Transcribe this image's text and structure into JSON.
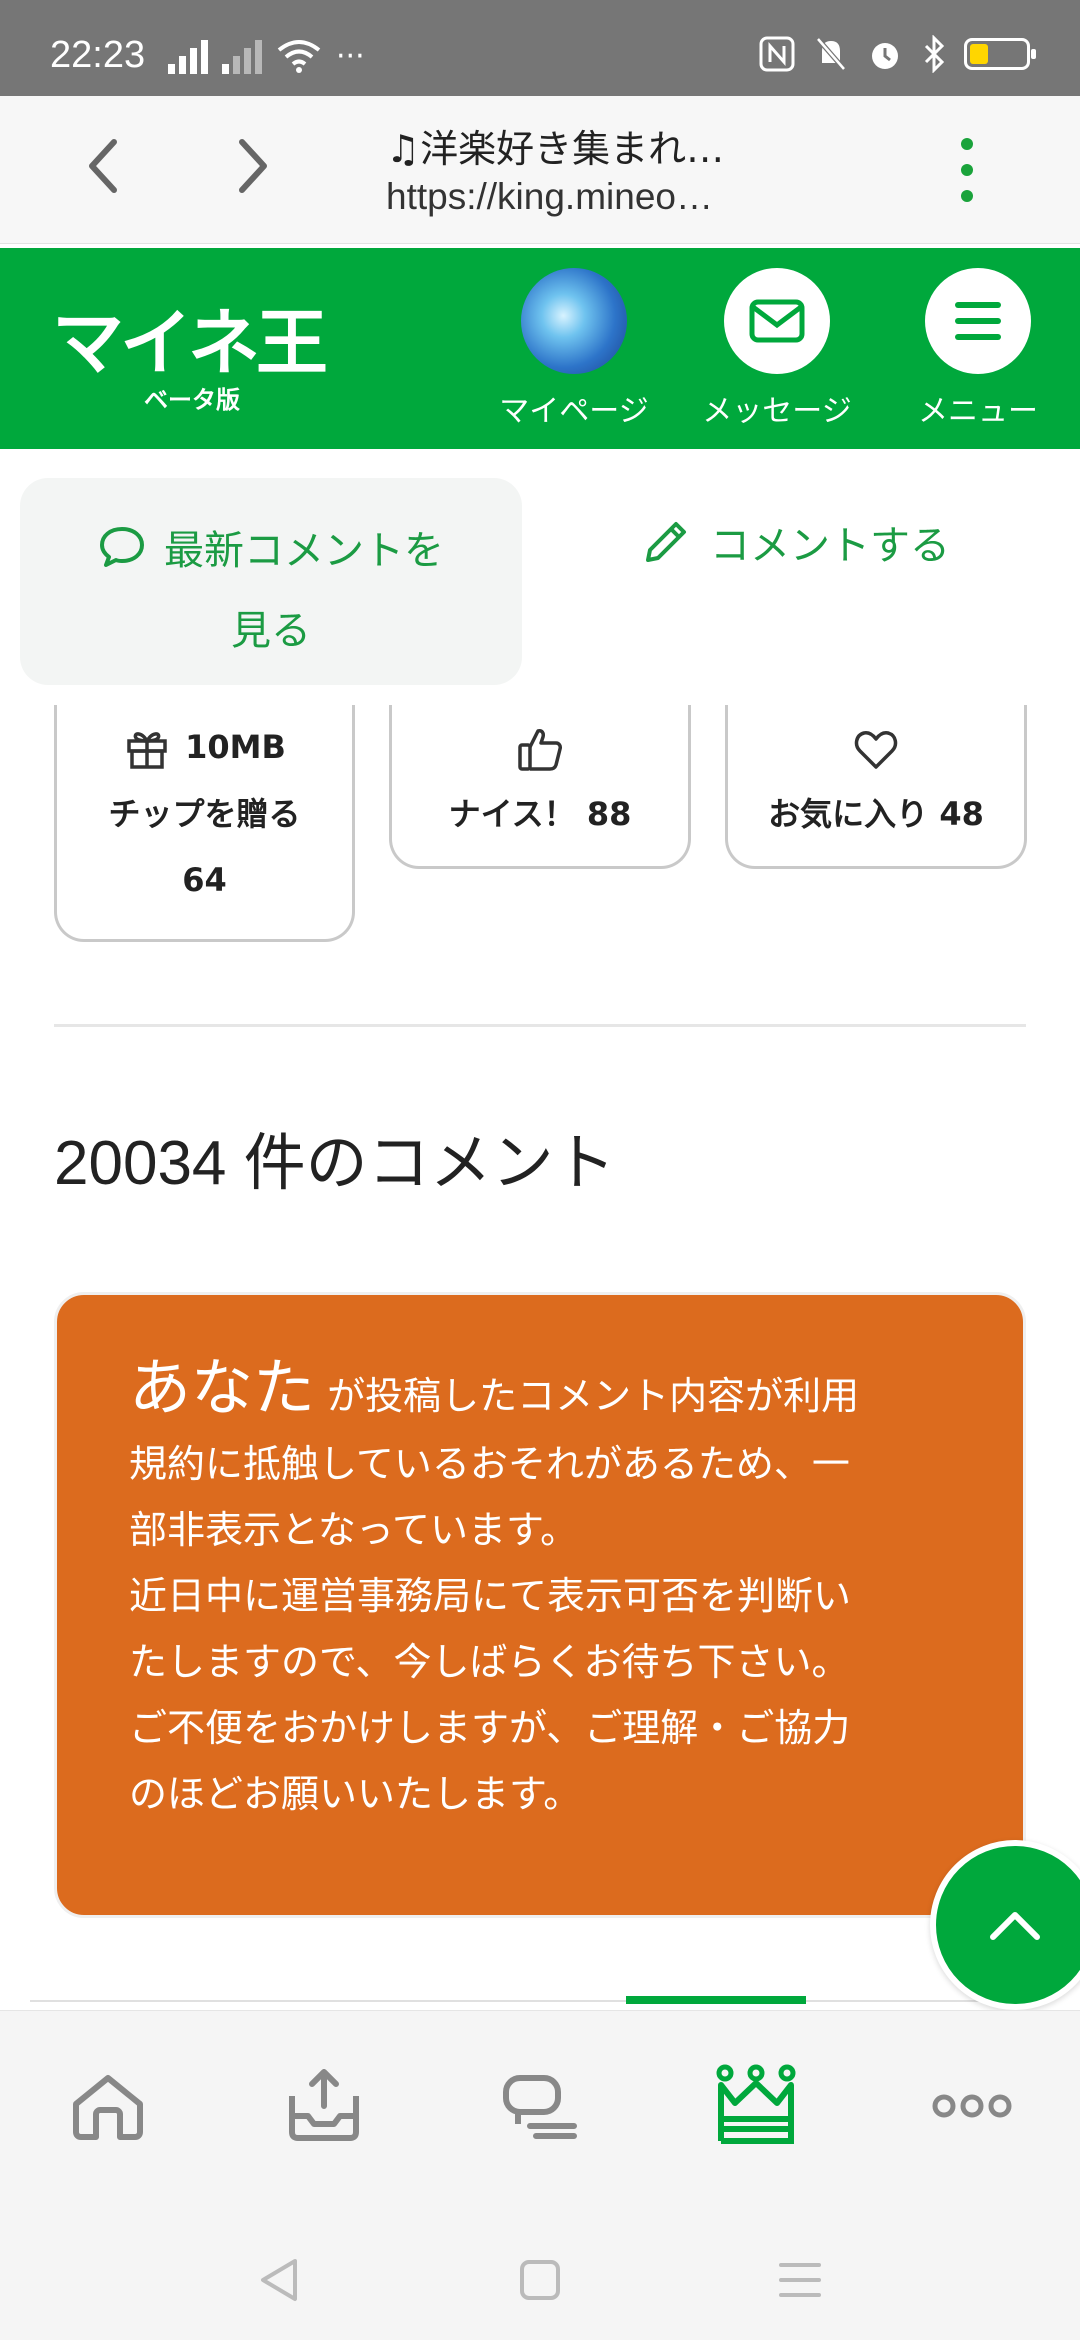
{
  "status_bar": {
    "time": "22:23",
    "overflow": "···"
  },
  "browser": {
    "title": "♫洋楽好き集まれ…",
    "url": "https://king.mineo…"
  },
  "header": {
    "logo_text": "マイネ王",
    "logo_sub": "ベータ版",
    "mypage_label": "マイページ",
    "message_label": "メッセージ",
    "menu_label": "メニュー"
  },
  "actions": {
    "latest_line1": "最新コメントを",
    "latest_line2": "見る",
    "write_comment": "コメントする"
  },
  "reactions": {
    "tip_amount": "10MB",
    "tip_label": "チップを贈る",
    "tip_count": "64",
    "nice_label": "ナイス！",
    "nice_count": "88",
    "fav_label": "お気に入り",
    "fav_count": "48"
  },
  "comments": {
    "count": "20034",
    "count_suffix": "件のコメント"
  },
  "notice": {
    "you": "あなた",
    "line1": "が投稿したコメント内容が利用",
    "lines": [
      "規約に抵触しているおそれがあるため、一",
      "部非表示となっています。",
      "近日中に運営事務局にて表示可否を判断い",
      "たしますので、今しばらくお待ち下さい。",
      "ご不便をおかけしますが、ご理解・ご協力",
      "のほどお願いいたします。"
    ]
  },
  "colors": {
    "brand_green": "#00a83c",
    "notice_orange": "#dc6b1e"
  },
  "bottom_nav": {
    "active": "king-icon"
  }
}
